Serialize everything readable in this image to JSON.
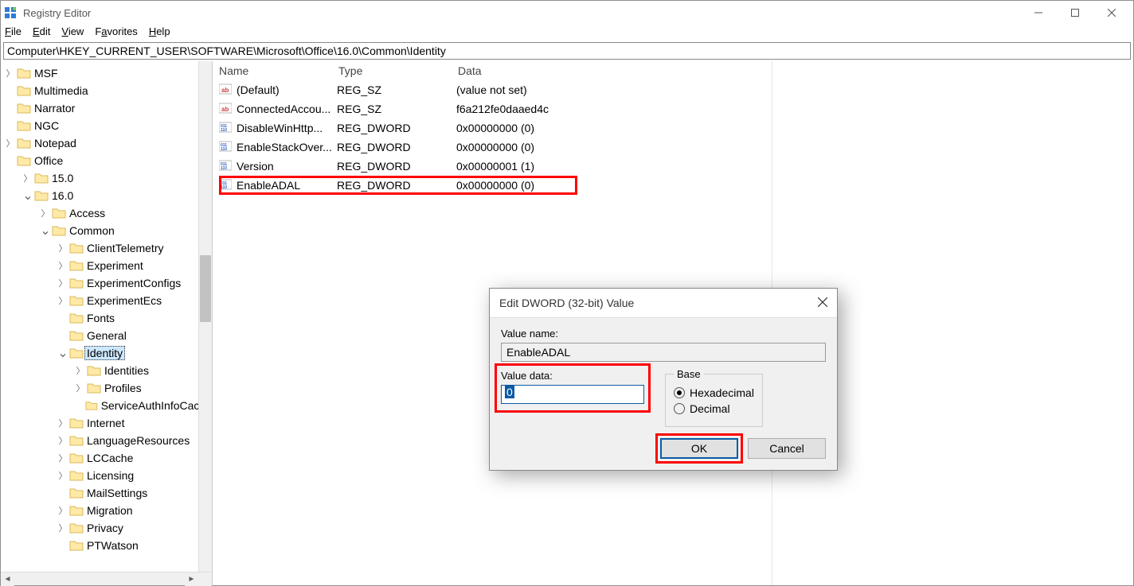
{
  "window": {
    "title": "Registry Editor"
  },
  "menu": {
    "file": "File",
    "edit": "Edit",
    "view": "View",
    "favorites": "Favorites",
    "help": "Help"
  },
  "address": "Computer\\HKEY_CURRENT_USER\\SOFTWARE\\Microsoft\\Office\\16.0\\Common\\Identity",
  "tree": [
    {
      "indent": 0,
      "tw": ">",
      "label": "MSF"
    },
    {
      "indent": 0,
      "tw": "",
      "label": "Multimedia"
    },
    {
      "indent": 0,
      "tw": "",
      "label": "Narrator"
    },
    {
      "indent": 0,
      "tw": "",
      "label": "NGC"
    },
    {
      "indent": 0,
      "tw": ">",
      "label": "Notepad"
    },
    {
      "indent": 0,
      "tw": "",
      "label": "Office"
    },
    {
      "indent": 1,
      "tw": ">",
      "label": "15.0"
    },
    {
      "indent": 1,
      "tw": "v",
      "label": "16.0"
    },
    {
      "indent": 2,
      "tw": ">",
      "label": "Access"
    },
    {
      "indent": 2,
      "tw": "v",
      "label": "Common"
    },
    {
      "indent": 3,
      "tw": ">",
      "label": "ClientTelemetry"
    },
    {
      "indent": 3,
      "tw": ">",
      "label": "Experiment"
    },
    {
      "indent": 3,
      "tw": ">",
      "label": "ExperimentConfigs"
    },
    {
      "indent": 3,
      "tw": ">",
      "label": "ExperimentEcs"
    },
    {
      "indent": 3,
      "tw": "",
      "label": "Fonts"
    },
    {
      "indent": 3,
      "tw": "",
      "label": "General"
    },
    {
      "indent": 3,
      "tw": "v",
      "label": "Identity",
      "selected": true
    },
    {
      "indent": 4,
      "tw": ">",
      "label": "Identities"
    },
    {
      "indent": 4,
      "tw": ">",
      "label": "Profiles"
    },
    {
      "indent": 4,
      "tw": "",
      "label": "ServiceAuthInfoCache"
    },
    {
      "indent": 3,
      "tw": ">",
      "label": "Internet"
    },
    {
      "indent": 3,
      "tw": ">",
      "label": "LanguageResources"
    },
    {
      "indent": 3,
      "tw": ">",
      "label": "LCCache"
    },
    {
      "indent": 3,
      "tw": ">",
      "label": "Licensing"
    },
    {
      "indent": 3,
      "tw": "",
      "label": "MailSettings"
    },
    {
      "indent": 3,
      "tw": ">",
      "label": "Migration"
    },
    {
      "indent": 3,
      "tw": ">",
      "label": "Privacy"
    },
    {
      "indent": 3,
      "tw": "",
      "label": "PTWatson"
    }
  ],
  "columns": {
    "name": "Name",
    "type": "Type",
    "data": "Data"
  },
  "values": [
    {
      "name": "(Default)",
      "type": "REG_SZ",
      "data": "(value not set)",
      "icon": "sz"
    },
    {
      "name": "ConnectedAccou...",
      "type": "REG_SZ",
      "data": "f6a212fe0daaed4c",
      "icon": "sz"
    },
    {
      "name": "DisableWinHttp...",
      "type": "REG_DWORD",
      "data": "0x00000000 (0)",
      "icon": "bin"
    },
    {
      "name": "EnableStackOver...",
      "type": "REG_DWORD",
      "data": "0x00000000 (0)",
      "icon": "bin"
    },
    {
      "name": "Version",
      "type": "REG_DWORD",
      "data": "0x00000001 (1)",
      "icon": "bin"
    },
    {
      "name": "EnableADAL",
      "type": "REG_DWORD",
      "data": "0x00000000 (0)",
      "icon": "bin"
    }
  ],
  "dialog": {
    "title": "Edit DWORD (32-bit) Value",
    "valuename_label": "Value name:",
    "valuename": "EnableADAL",
    "valuedata_label": "Value data:",
    "valuedata": "0",
    "base_label": "Base",
    "hex": "Hexadecimal",
    "dec": "Decimal",
    "ok": "OK",
    "cancel": "Cancel"
  }
}
